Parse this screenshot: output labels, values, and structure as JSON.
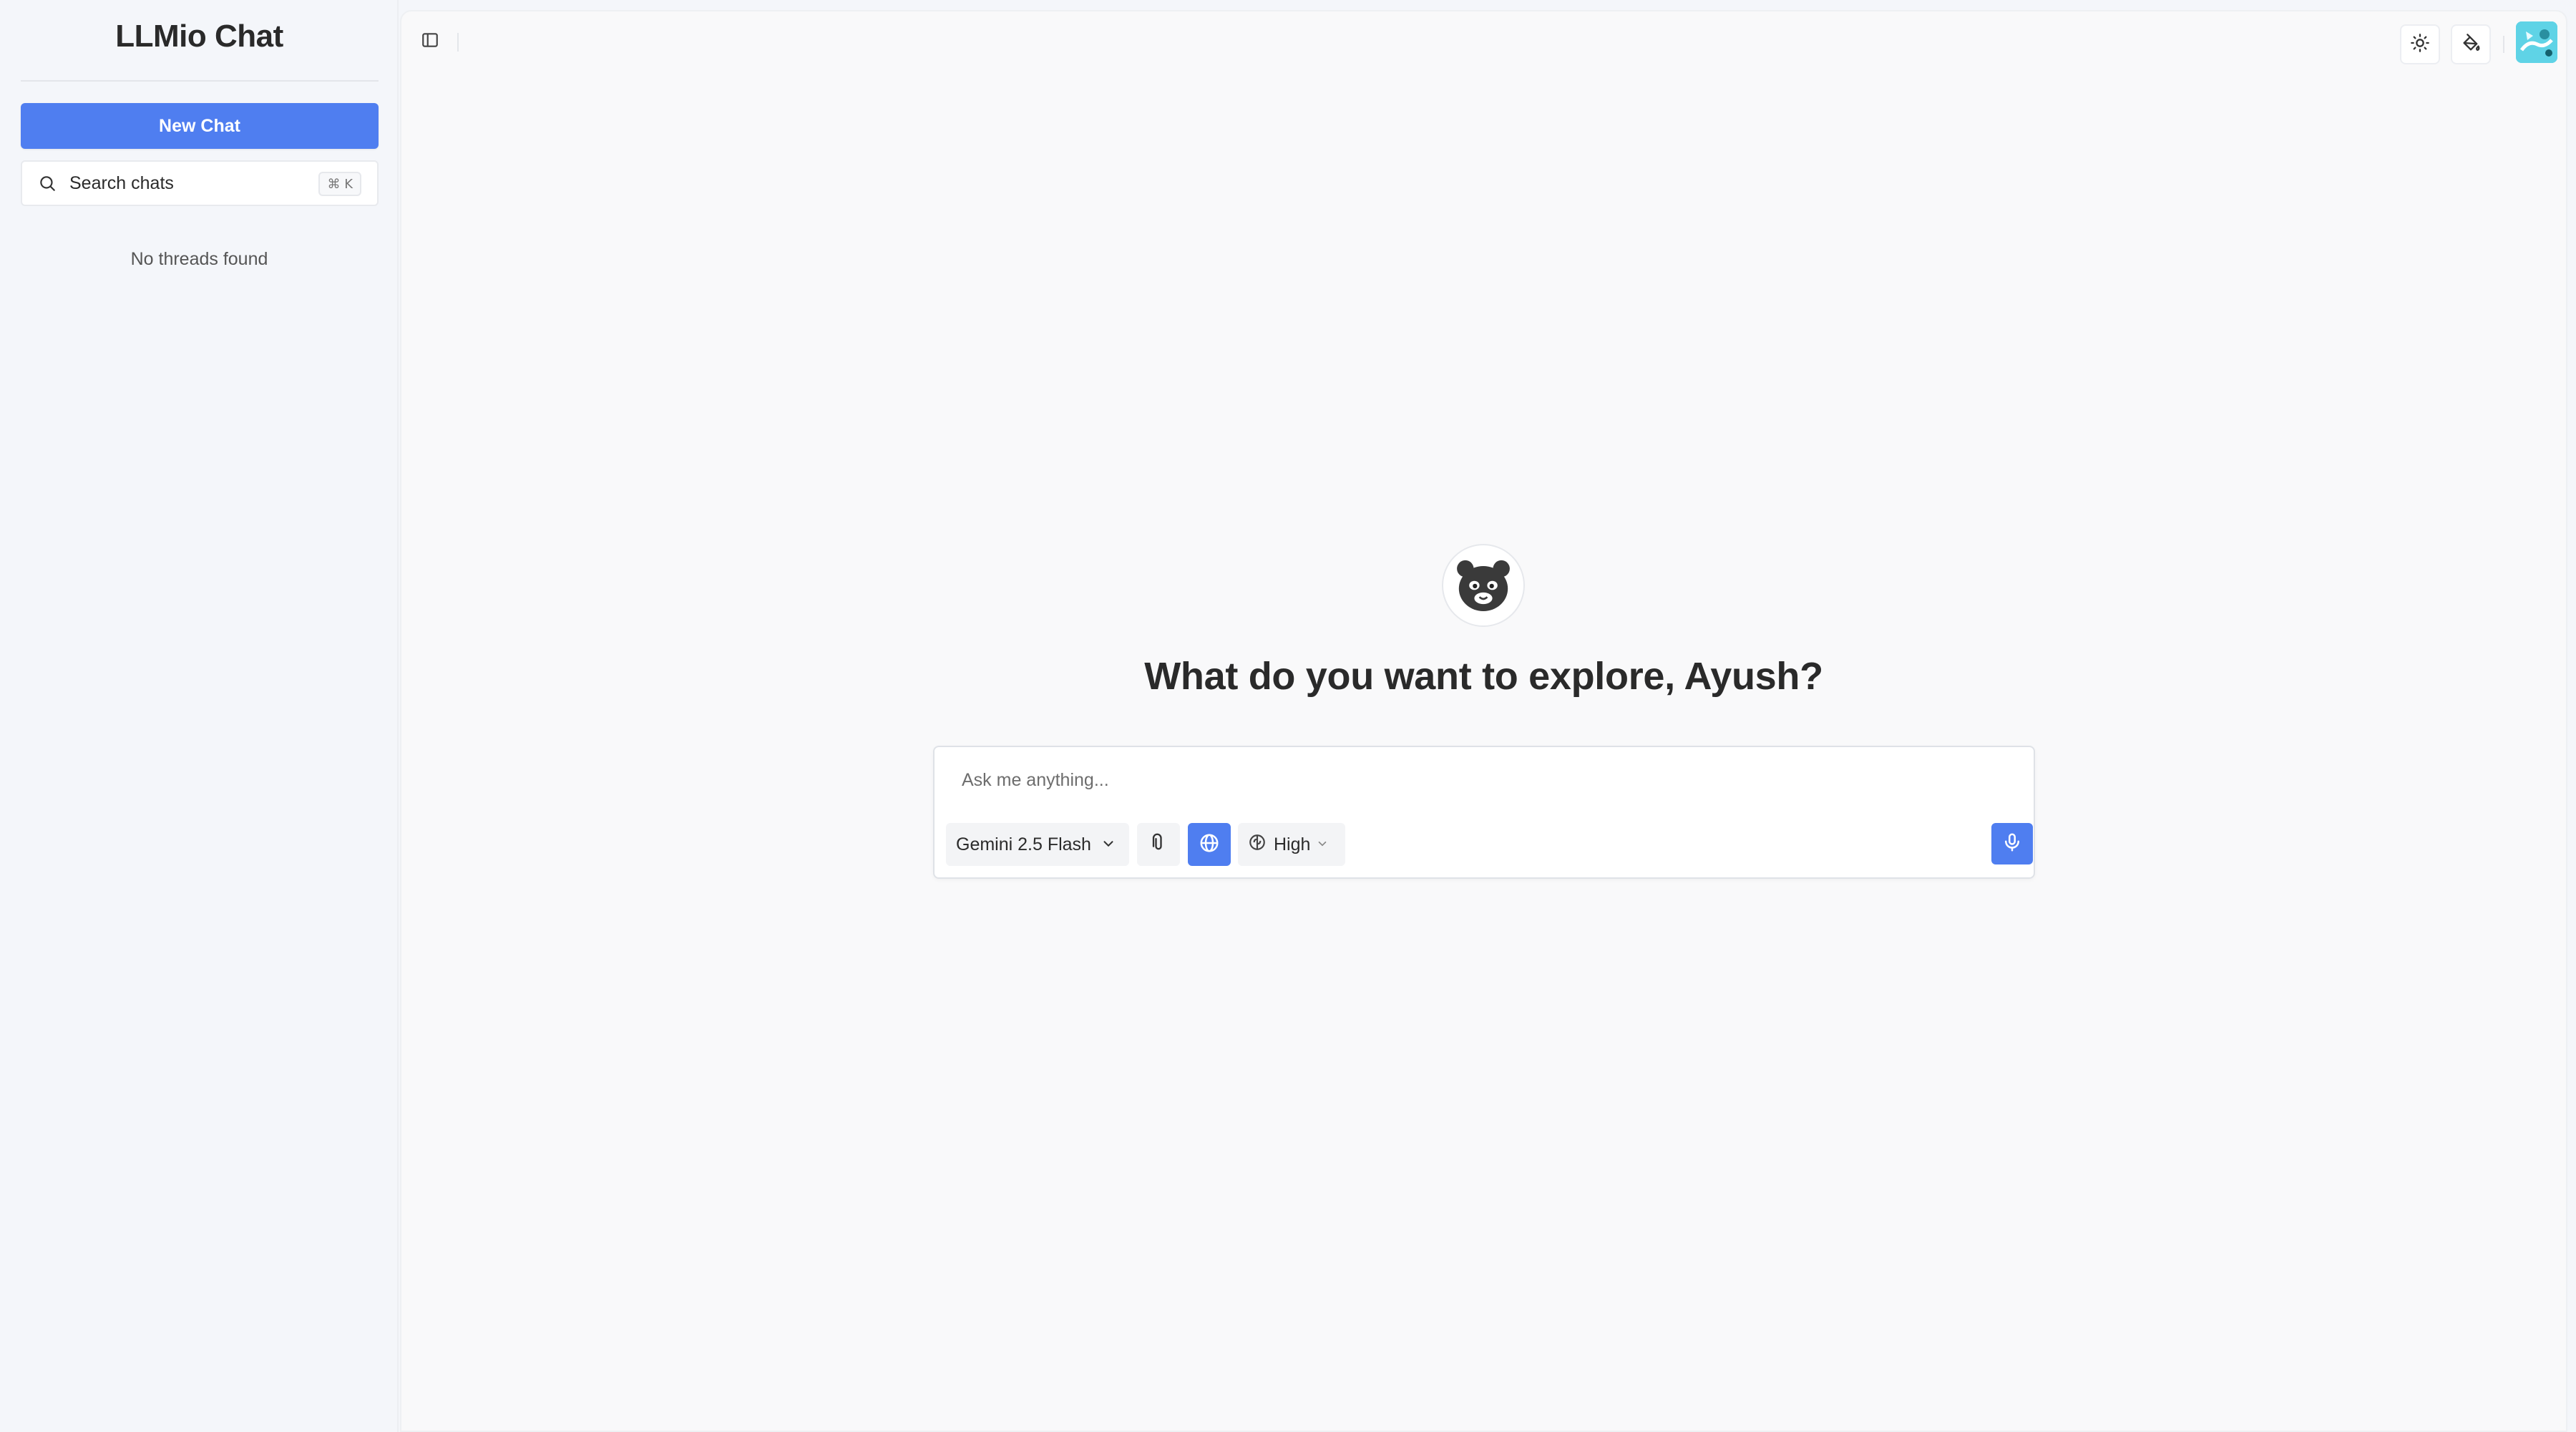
{
  "sidebar": {
    "app_title": "LLMio Chat",
    "new_chat_label": "New Chat",
    "search": {
      "label": "Search chats",
      "shortcut": "⌘ K"
    },
    "empty_text": "No threads found"
  },
  "header": {
    "icons": [
      "sidebar-toggle-icon",
      "sun-icon",
      "paint-bucket-icon"
    ],
    "avatar_color": "#5fd3e6"
  },
  "main": {
    "greeting": "What do you want to explore, Ayush?",
    "composer": {
      "placeholder": "Ask me anything...",
      "model": "Gemini 2.5 Flash",
      "reasoning_effort": "High",
      "web_search_enabled": true
    }
  },
  "colors": {
    "accent": "#4f7ef0",
    "background": "#f4f6fa",
    "panel": "#f9f9fa"
  }
}
